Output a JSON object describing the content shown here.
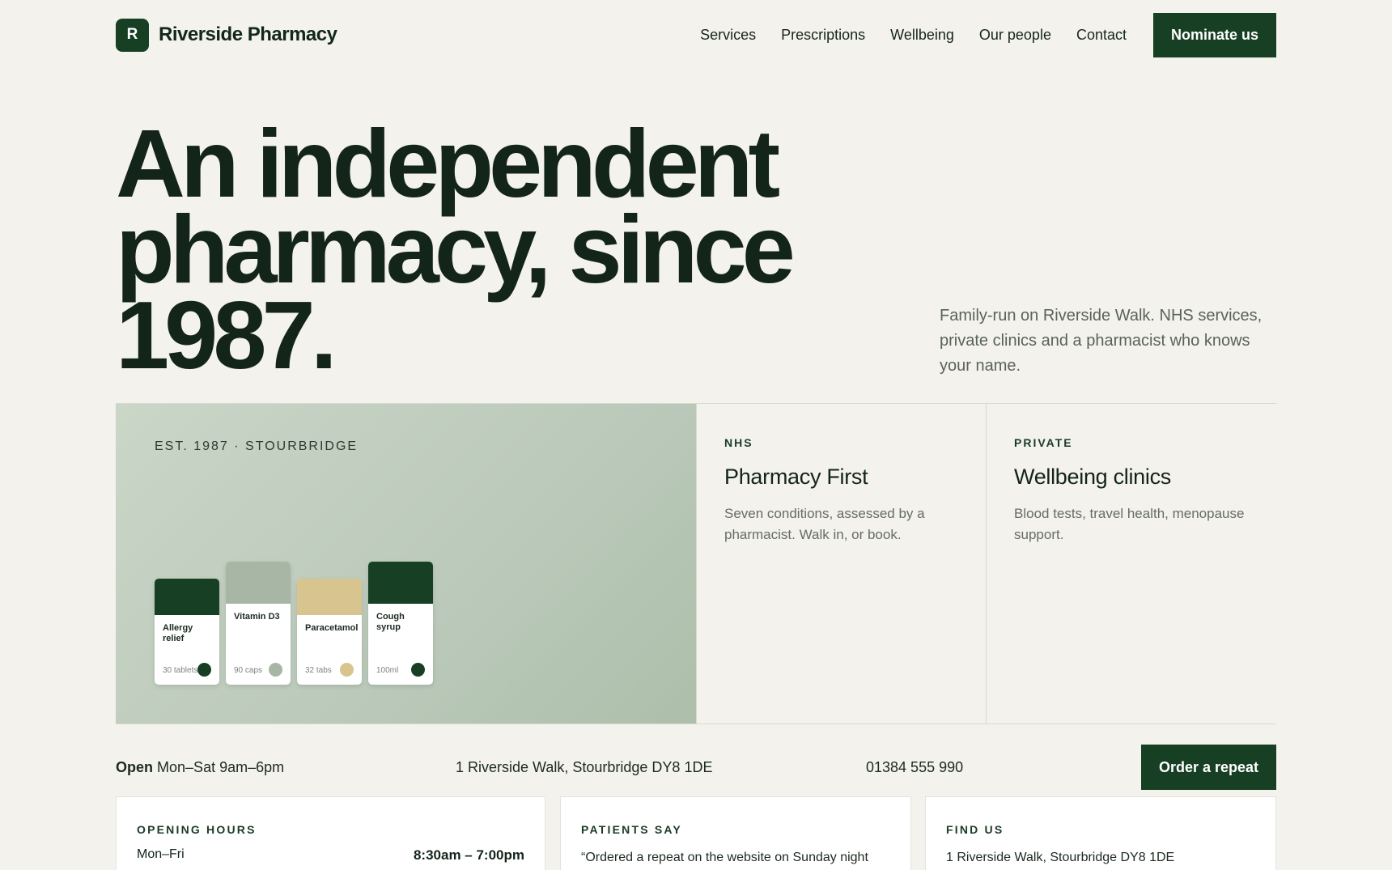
{
  "brand": {
    "mark": "R",
    "name": "Riverside Pharmacy"
  },
  "nav": {
    "links": [
      "Services",
      "Prescriptions",
      "Wellbeing",
      "Our people",
      "Contact"
    ],
    "cta": "Nominate us"
  },
  "hero": {
    "line1": "An independent",
    "line2": "pharmacy, since",
    "line3": "1987.",
    "subtitle": "Family-run on Riverside Walk. NHS services, private clinics and a pharmacist who knows your name."
  },
  "feature_image": {
    "label": "EST. 1987 · STOURBRIDGE",
    "boxes": [
      {
        "name": "Allergy relief",
        "qty": "30 tablets",
        "color": "#173f24"
      },
      {
        "name": "Vitamin D3",
        "qty": "90 caps",
        "color": "#a8b7a5"
      },
      {
        "name": "Paracetamol",
        "qty": "32 tabs",
        "color": "#d8c48e"
      },
      {
        "name": "Cough syrup",
        "qty": "100ml",
        "color": "#173f24"
      }
    ]
  },
  "cards": [
    {
      "kicker": "NHS",
      "title": "Pharmacy First",
      "desc": "Seven conditions, assessed by a pharmacist. Walk in, or book."
    },
    {
      "kicker": "PRIVATE",
      "title": "Wellbeing clinics",
      "desc": "Blood tests, travel health, menopause support."
    }
  ],
  "info": {
    "open_label": "Open",
    "open_hours": "Mon–Sat 9am–6pm",
    "address": "1 Riverside Walk, Stourbridge DY8 1DE",
    "phone": "01384 555 990",
    "cta": "Order a repeat"
  },
  "bottom": {
    "hours": {
      "title": "OPENING HOURS",
      "day": "Mon–Fri",
      "time": "8:30am – 7:00pm"
    },
    "patients": {
      "title": "PATIENTS SAY",
      "quote": "“Ordered a repeat on the website on Sunday night"
    },
    "find": {
      "title": "FIND US",
      "address": "1 Riverside Walk, Stourbridge DY8 1DE"
    }
  },
  "colors": {
    "accent": "#173f24",
    "background": "#f3f2ec",
    "muted_text": "#5a625c"
  }
}
